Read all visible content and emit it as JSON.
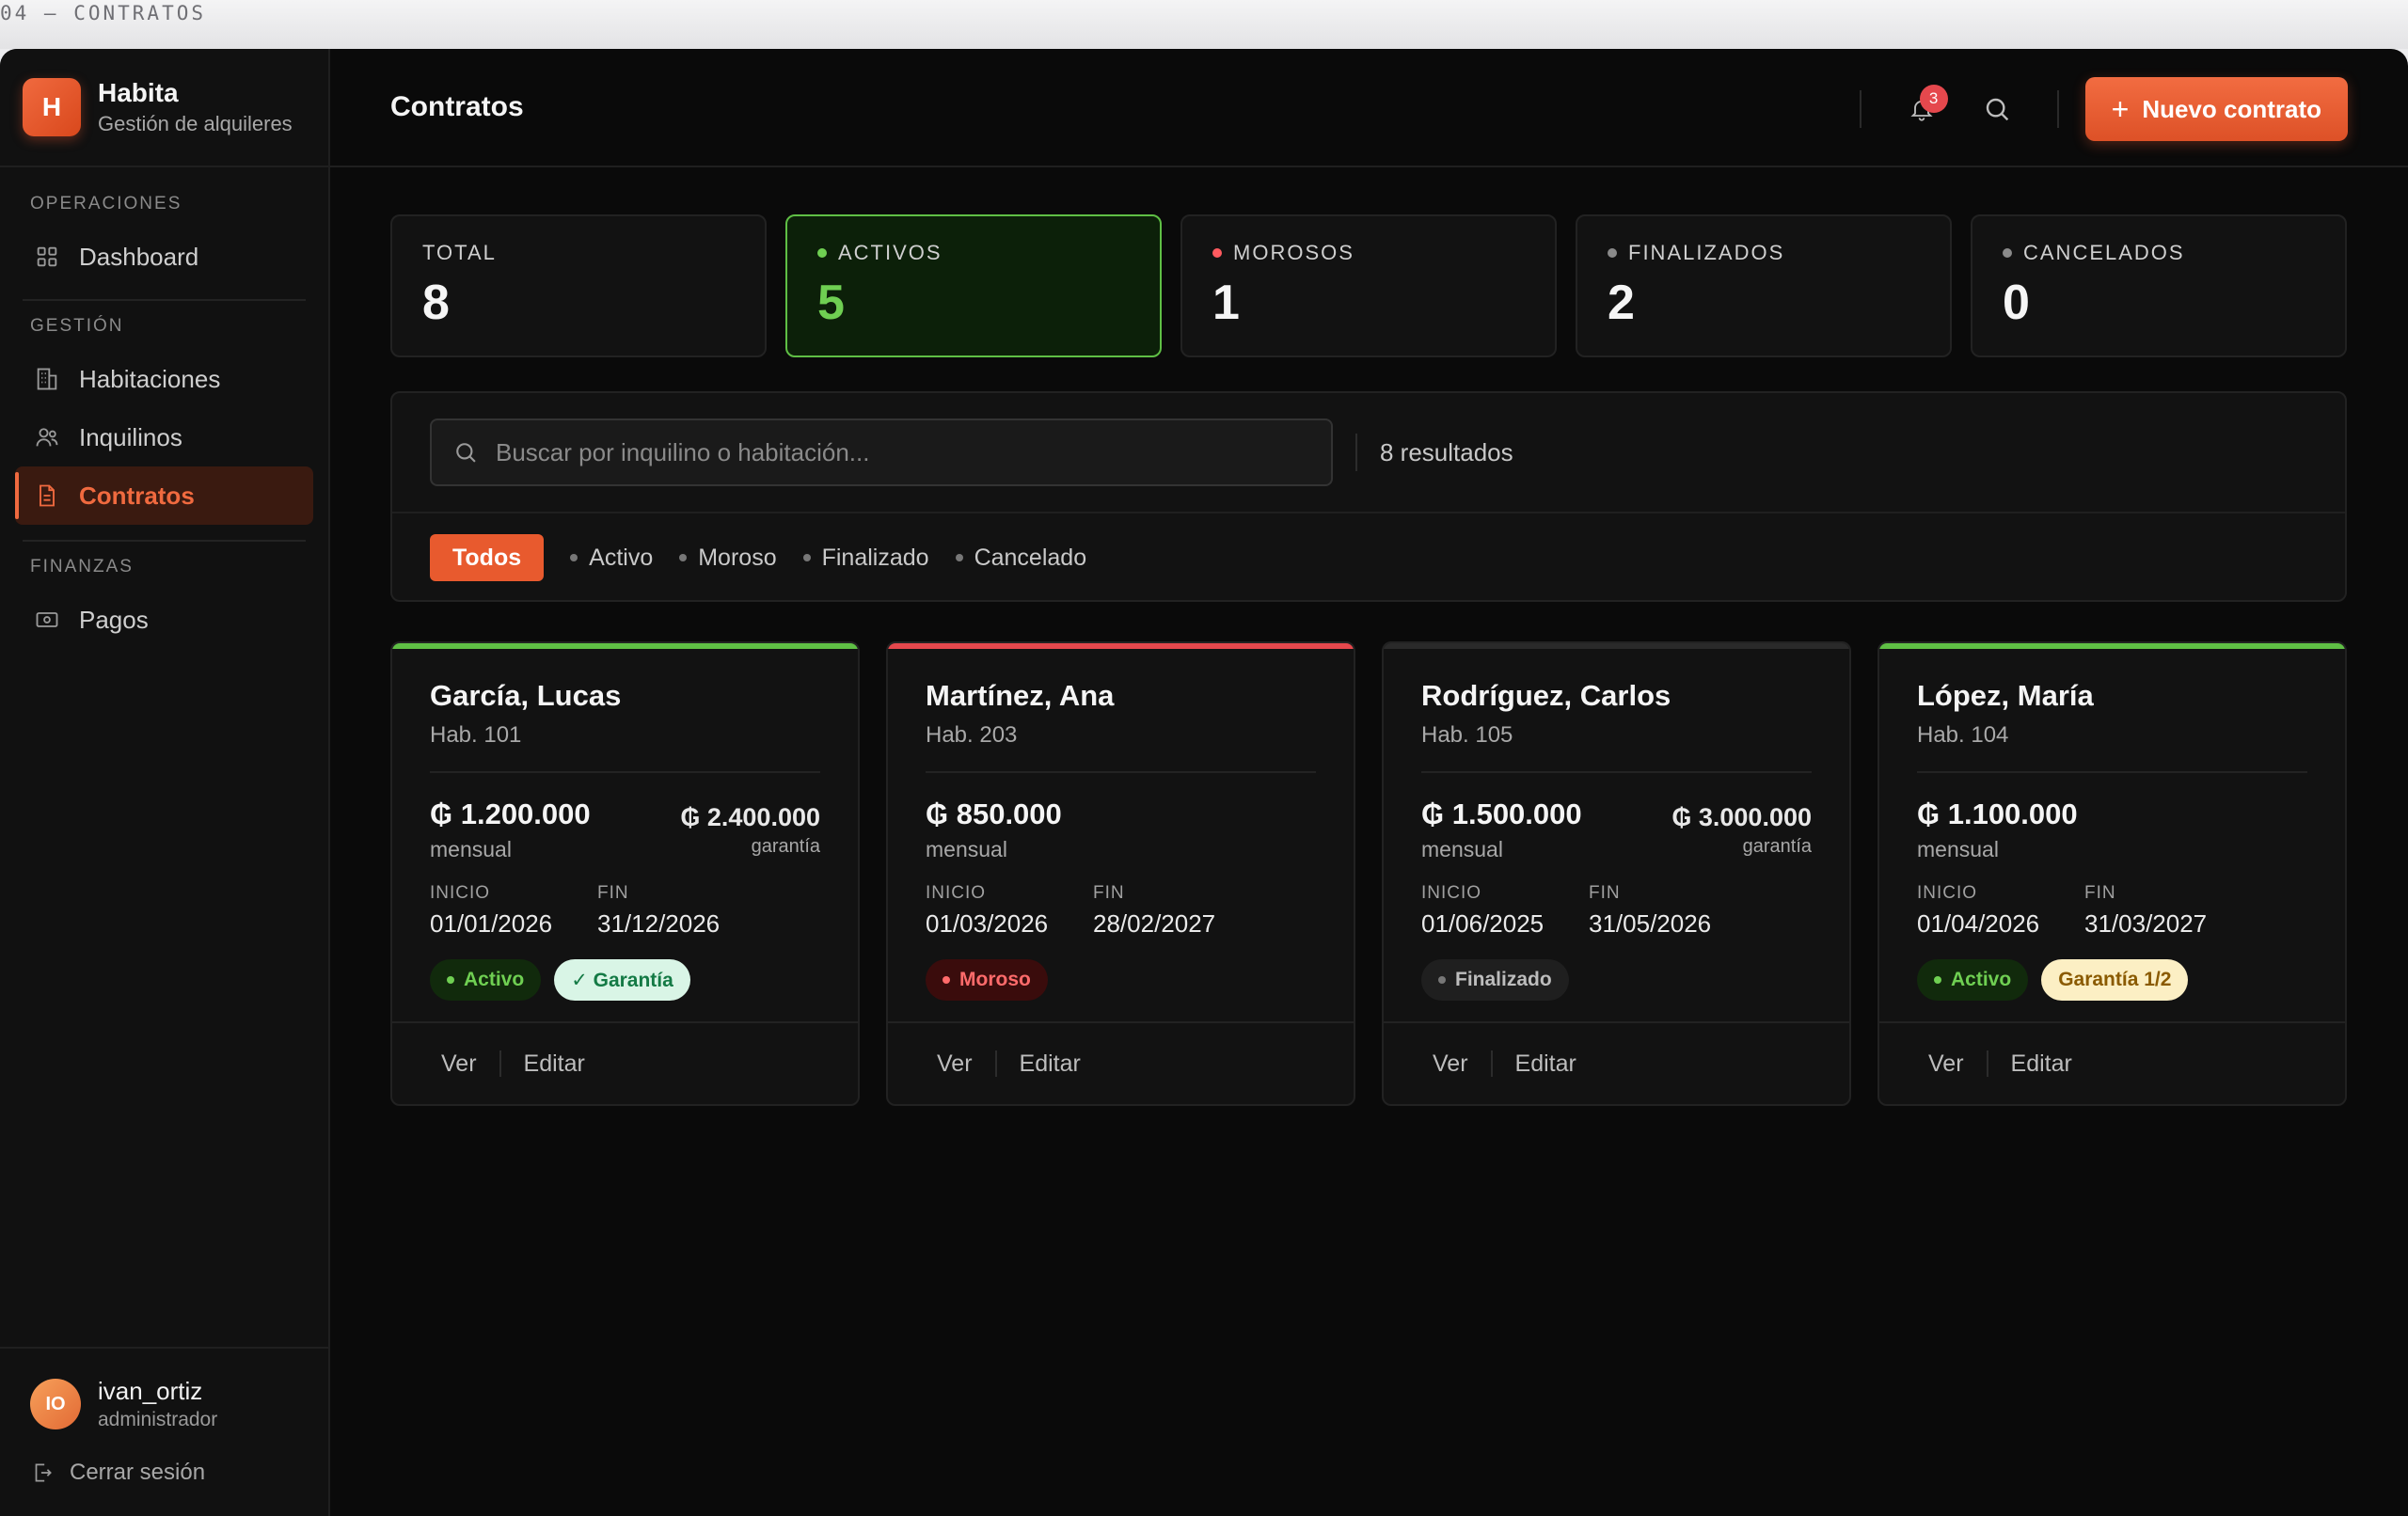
{
  "page_label": "04 — CONTRATOS",
  "brand": {
    "logo_letter": "H",
    "name": "Habita",
    "subtitle": "Gestión de alquileres"
  },
  "sidebar": {
    "sections": [
      {
        "title": "OPERACIONES",
        "items": [
          {
            "label": "Dashboard",
            "icon": "grid-icon"
          }
        ]
      },
      {
        "title": "GESTIÓN",
        "items": [
          {
            "label": "Habitaciones",
            "icon": "building-icon"
          },
          {
            "label": "Inquilinos",
            "icon": "users-icon"
          },
          {
            "label": "Contratos",
            "icon": "document-icon",
            "active": true
          }
        ]
      },
      {
        "title": "FINANZAS",
        "items": [
          {
            "label": "Pagos",
            "icon": "banknote-icon"
          }
        ]
      }
    ]
  },
  "user": {
    "initials": "IO",
    "name": "ivan_ortiz",
    "role": "administrador",
    "logout_label": "Cerrar sesión"
  },
  "header": {
    "title": "Contratos",
    "notifications_count": "3",
    "new_button": "Nuevo contrato"
  },
  "stats": [
    {
      "label": "TOTAL",
      "value": "8",
      "dot": ""
    },
    {
      "label": "ACTIVOS",
      "value": "5",
      "dot": "#6fcf52",
      "active": true
    },
    {
      "label": "MOROSOS",
      "value": "1",
      "dot": "#ff5a5f"
    },
    {
      "label": "FINALIZADOS",
      "value": "2",
      "dot": "#8a8a8a"
    },
    {
      "label": "CANCELADOS",
      "value": "0",
      "dot": "#8a8a8a"
    }
  ],
  "search": {
    "placeholder": "Buscar por inquilino o habitación...",
    "value": "",
    "results": "8 resultados"
  },
  "filters": [
    {
      "label": "Todos",
      "active": true
    },
    {
      "label": "Activo"
    },
    {
      "label": "Moroso"
    },
    {
      "label": "Finalizado"
    },
    {
      "label": "Cancelado"
    }
  ],
  "contracts": [
    {
      "name": "García, Lucas",
      "room": "Hab. 101",
      "monthly": "₲ 1.200.000",
      "monthly_label": "mensual",
      "deposit": "₲ 2.400.000",
      "deposit_label": "garantía",
      "start_label": "INICIO",
      "start": "01/01/2026",
      "end_label": "FIN",
      "end": "31/12/2026",
      "status": "Activo",
      "status_class": "activo",
      "guarantee": "✓ Garantía",
      "guarantee_class": "garantia-ok",
      "bar_color": "#5fbf45",
      "view": "Ver",
      "edit": "Editar"
    },
    {
      "name": "Martínez, Ana",
      "room": "Hab. 203",
      "monthly": "₲ 850.000",
      "monthly_label": "mensual",
      "deposit": "",
      "deposit_label": "",
      "start_label": "INICIO",
      "start": "01/03/2026",
      "end_label": "FIN",
      "end": "28/02/2027",
      "status": "Moroso",
      "status_class": "moroso",
      "guarantee": "",
      "guarantee_class": "",
      "bar_color": "#e5484d",
      "view": "Ver",
      "edit": "Editar"
    },
    {
      "name": "Rodríguez, Carlos",
      "room": "Hab. 105",
      "monthly": "₲ 1.500.000",
      "monthly_label": "mensual",
      "deposit": "₲ 3.000.000",
      "deposit_label": "garantía",
      "start_label": "INICIO",
      "start": "01/06/2025",
      "end_label": "FIN",
      "end": "31/05/2026",
      "status": "Finalizado",
      "status_class": "finalizado",
      "guarantee": "",
      "guarantee_class": "",
      "bar_color": "#2a2a2a",
      "view": "Ver",
      "edit": "Editar"
    },
    {
      "name": "López, María",
      "room": "Hab. 104",
      "monthly": "₲ 1.100.000",
      "monthly_label": "mensual",
      "deposit": "",
      "deposit_label": "",
      "start_label": "INICIO",
      "start": "01/04/2026",
      "end_label": "FIN",
      "end": "31/03/2027",
      "status": "Activo",
      "status_class": "activo",
      "guarantee": "Garantía 1/2",
      "guarantee_class": "garantia-partial",
      "bar_color": "#5fbf45",
      "view": "Ver",
      "edit": "Editar"
    }
  ]
}
